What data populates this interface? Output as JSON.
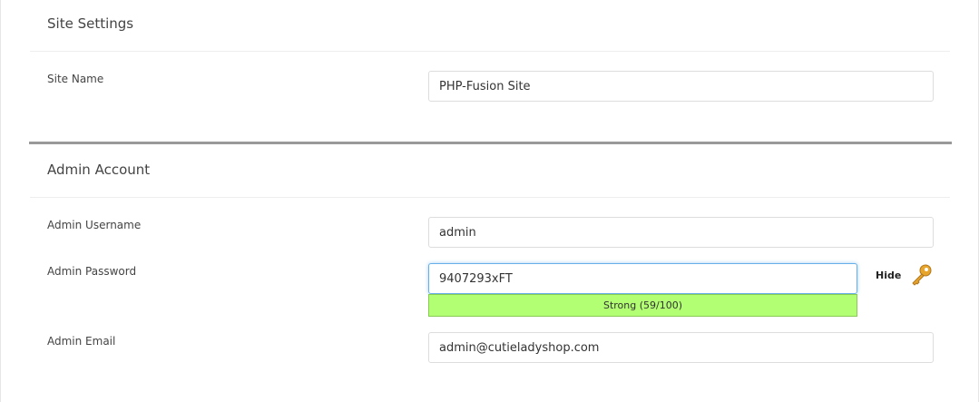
{
  "site_settings": {
    "title": "Site Settings",
    "site_name_label": "Site Name",
    "site_name_value": "PHP-Fusion Site"
  },
  "admin_account": {
    "title": "Admin Account",
    "username_label": "Admin Username",
    "username_value": "admin",
    "password_label": "Admin Password",
    "password_value": "9407293xFT",
    "strength_text": "Strong (59/100)",
    "hide_label": "Hide",
    "email_label": "Admin Email",
    "email_value": "admin@cutieladyshop.com"
  },
  "icons": {
    "password_generator": "key-icon"
  },
  "colors": {
    "strength_fill": "#b3ff73",
    "focus_border": "#66afe9",
    "section_divider": "#999999"
  }
}
